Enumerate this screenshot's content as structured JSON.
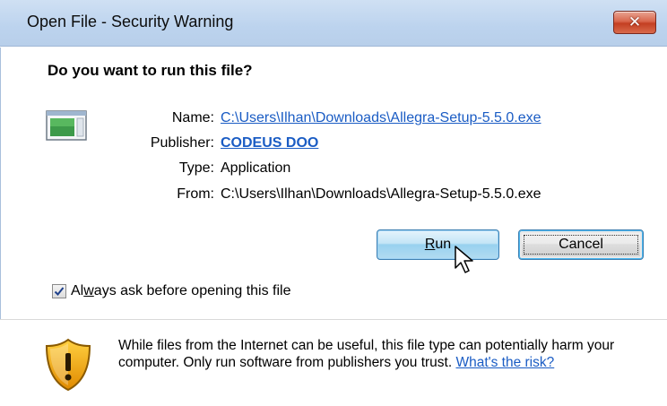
{
  "window": {
    "title": "Open File - Security Warning",
    "close_glyph": "✕"
  },
  "main": {
    "question": "Do you want to run this file?",
    "file_icon": "application-window-icon",
    "fields": {
      "name_label": "Name:",
      "name_value": "C:\\Users\\Ilhan\\Downloads\\Allegra-Setup-5.5.0.exe",
      "publisher_label": "Publisher:",
      "publisher_value": "CODEUS DOO",
      "type_label": "Type:",
      "type_value": "Application",
      "from_label": "From:",
      "from_value": "C:\\Users\\Ilhan\\Downloads\\Allegra-Setup-5.5.0.exe"
    },
    "buttons": {
      "run_accesskey": "R",
      "run_rest": "un",
      "cancel": "Cancel"
    },
    "checkbox": {
      "checked": true,
      "label_pre": "Al",
      "label_accesskey": "w",
      "label_post": "ays ask before opening this file"
    }
  },
  "footer": {
    "icon": "warning-shield-icon",
    "warning_text": "While files from the Internet can be useful, this file type can potentially harm your computer. Only run software from publishers you trust. ",
    "risk_link": "What's the risk?"
  },
  "colors": {
    "link": "#1a5cc4",
    "titlebar": "#c4d8f0",
    "close_button": "#c9472a",
    "shield_orange": "#f0a000"
  }
}
